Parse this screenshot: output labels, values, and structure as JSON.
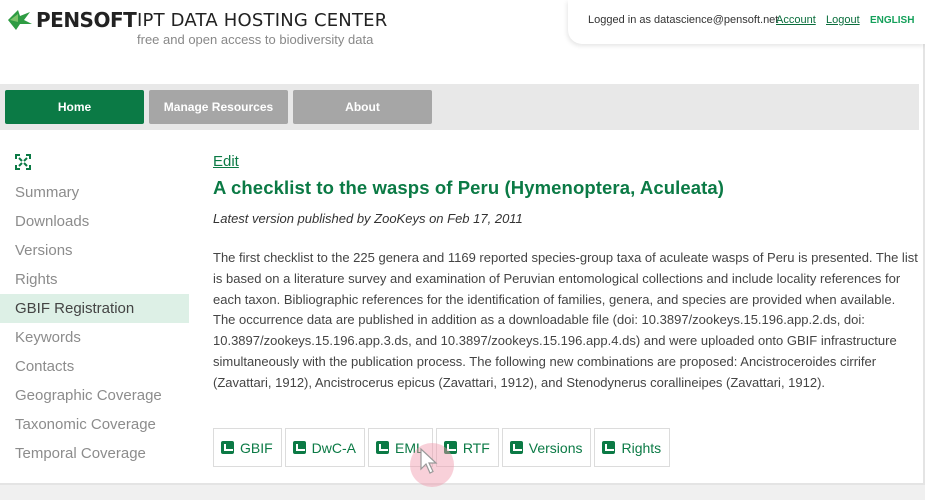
{
  "header": {
    "logo_text": "PENSOFT",
    "title": "IPT DATA HOSTING CENTER",
    "subtitle": "free and open access to biodiversity data",
    "logged_in_text": "Logged in as datascience@pensoft.net",
    "account_link": "Account",
    "logout_link": "Logout",
    "language": "ENGLISH"
  },
  "nav": {
    "home": "Home",
    "manage_resources": "Manage Resources",
    "about": "About"
  },
  "sidebar": {
    "items": [
      {
        "label": "Summary"
      },
      {
        "label": "Downloads"
      },
      {
        "label": "Versions"
      },
      {
        "label": "Rights"
      },
      {
        "label": "GBIF Registration"
      },
      {
        "label": "Keywords"
      },
      {
        "label": "Contacts"
      },
      {
        "label": "Geographic Coverage"
      },
      {
        "label": "Taxonomic Coverage"
      },
      {
        "label": "Temporal Coverage"
      }
    ],
    "active_index": 4
  },
  "main": {
    "edit_link": "Edit",
    "title": "A checklist to the wasps of Peru (Hymenoptera, Aculeata)",
    "version_line": "Latest version published by ZooKeys on Feb 17, 2011",
    "abstract": "The first checklist to the 225 genera and 1169 reported species-group taxa of aculeate wasps of Peru is presented. The list is based on a literature survey and examination of Peruvian entomological collections and include locality references for each taxon. Bibliographic references for the identification of families, genera, and species are provided when available. The occurrence data are published in addition as a downloadable file (doi: 10.3897/zookeys.15.196.app.2.ds, doi: 10.3897/zookeys.15.196.app.3.ds, and 10.3897/zookeys.15.196.app.4.ds) and were uploaded onto GBIF infrastructure simultaneously with the publication process. The following new combinations are proposed: Ancistroceroides cirrifer (Zavattari, 1912), Ancistrocerus epicus (Zavattari, 1912), and Stenodynerus corallineipes (Zavattari, 1912).",
    "buttons": [
      {
        "label": "GBIF",
        "icon": "gbif-icon"
      },
      {
        "label": "DwC-A",
        "icon": "download-icon"
      },
      {
        "label": "EML",
        "icon": "download-icon"
      },
      {
        "label": "RTF",
        "icon": "download-icon"
      },
      {
        "label": "Versions",
        "icon": "versions-icon"
      },
      {
        "label": "Rights",
        "icon": "rights-icon"
      }
    ]
  },
  "colors": {
    "brand_green": "#0b7a45",
    "nav_inactive": "#a6a6a6",
    "active_sidebar_bg": "#ddf0e6"
  }
}
